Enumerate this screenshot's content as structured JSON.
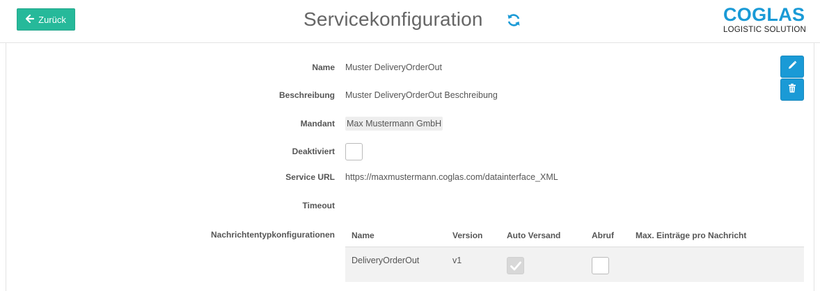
{
  "header": {
    "back_label": "Zurück",
    "title": "Servicekonfiguration",
    "refresh_icon": "refresh-icon",
    "logo": {
      "main": "COGLAS",
      "sub": "LOGISTIC SOLUTION",
      "color": "#1a9ad6"
    }
  },
  "colors": {
    "accent": "#1a9ad6",
    "back_button": "#26b99a"
  },
  "actions": {
    "edit_icon": "pencil-icon",
    "delete_icon": "trash-icon"
  },
  "fields": {
    "name": {
      "label": "Name",
      "value": "Muster DeliveryOrderOut"
    },
    "description": {
      "label": "Beschreibung",
      "value": "Muster DeliveryOrderOut Beschreibung"
    },
    "client": {
      "label": "Mandant",
      "value": "Max Mustermann GmbH"
    },
    "deactivated": {
      "label": "Deaktiviert",
      "checked": false
    },
    "service_url": {
      "label": "Service URL",
      "value": "https://maxmustermann.coglas.com/datainterface_XML"
    },
    "timeout": {
      "label": "Timeout",
      "value": ""
    },
    "message_types": {
      "label": "Nachrichtentypkonfigurationen"
    }
  },
  "message_table": {
    "columns": [
      "Name",
      "Version",
      "Auto Versand",
      "Abruf",
      "Max. Einträge pro Nachricht"
    ],
    "rows": [
      {
        "name": "DeliveryOrderOut",
        "version": "v1",
        "auto_send": true,
        "fetch": false,
        "max_entries": ""
      }
    ]
  }
}
